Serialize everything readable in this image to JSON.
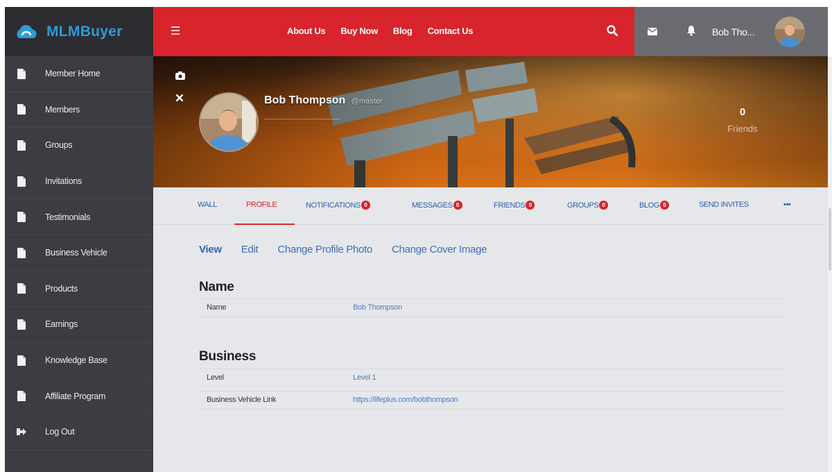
{
  "brand": {
    "name": "MLMBuyer"
  },
  "sidebar": {
    "items": [
      {
        "label": "Member Home",
        "icon": "document-icon"
      },
      {
        "label": "Members",
        "icon": "document-icon"
      },
      {
        "label": "Groups",
        "icon": "document-icon"
      },
      {
        "label": "Invitations",
        "icon": "document-icon"
      },
      {
        "label": "Testimonials",
        "icon": "document-icon"
      },
      {
        "label": "Business Vehicle",
        "icon": "document-icon"
      },
      {
        "label": "Products",
        "icon": "document-icon"
      },
      {
        "label": "Earnings",
        "icon": "document-icon"
      },
      {
        "label": "Knowledge Base",
        "icon": "document-icon"
      },
      {
        "label": "Affiliate Program",
        "icon": "document-icon"
      },
      {
        "label": "Log Out",
        "icon": "logout-icon"
      }
    ]
  },
  "topnav": {
    "links": [
      "About Us",
      "Buy Now",
      "Blog",
      "Contact Us"
    ]
  },
  "user": {
    "short_name": "Bob Tho..."
  },
  "profile": {
    "name": "Bob Thompson",
    "handle": "@master",
    "friends_count": "0",
    "friends_label": "Friends"
  },
  "tabs": {
    "items": [
      {
        "label": "WALL",
        "badge": ""
      },
      {
        "label": "PROFILE",
        "badge": ""
      },
      {
        "label": "NOTIFICATIONS",
        "badge": "0"
      },
      {
        "label": "MESSAGES",
        "badge": "0"
      },
      {
        "label": "FRIENDS",
        "badge": "0"
      },
      {
        "label": "GROUPS",
        "badge": "0"
      },
      {
        "label": "BLOG",
        "badge": "0"
      },
      {
        "label": "SEND INVITES",
        "badge": ""
      },
      {
        "label": "•••",
        "badge": ""
      }
    ]
  },
  "subnav": {
    "items": [
      "View",
      "Edit",
      "Change Profile Photo",
      "Change Cover Image"
    ]
  },
  "sections": {
    "name": {
      "title": "Name",
      "rows": [
        {
          "label": "Name",
          "value": "Bob Thompson"
        }
      ]
    },
    "business": {
      "title": "Business",
      "rows": [
        {
          "label": "Level",
          "value": "Level 1"
        },
        {
          "label": "Business Vehicle Link",
          "value": "https://lifeplus.com/bobthompson"
        }
      ]
    }
  },
  "colors": {
    "brand_red": "#d8242d",
    "sidebar_bg": "#3c3c42",
    "link_blue": "#3c6fb8",
    "logo_blue": "#2e9bd6"
  }
}
